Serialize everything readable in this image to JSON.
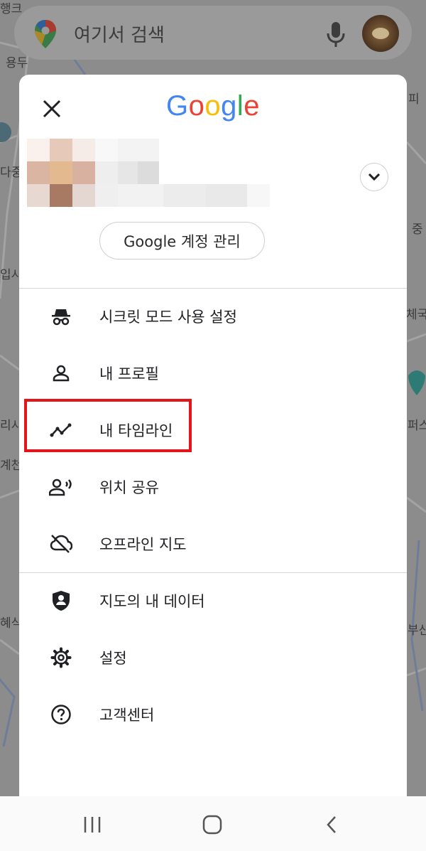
{
  "search": {
    "placeholder": "여기서 검색"
  },
  "panel": {
    "close_label": "close",
    "logo_letters": [
      {
        "ch": "G",
        "color": "#4285F4"
      },
      {
        "ch": "o",
        "color": "#EA4335"
      },
      {
        "ch": "o",
        "color": "#FBBC05"
      },
      {
        "ch": "g",
        "color": "#4285F4"
      },
      {
        "ch": "l",
        "color": "#34A853"
      },
      {
        "ch": "e",
        "color": "#EA4335"
      }
    ],
    "manage_account": "Google 계정 관리"
  },
  "menu": {
    "incognito": "시크릿 모드 사용 설정",
    "profile": "내 프로필",
    "timeline": "내 타임라인",
    "location_sharing": "위치 공유",
    "offline_maps": "오프라인 지도",
    "your_data": "지도의 내 데이터",
    "settings": "설정",
    "help": "고객센터"
  },
  "map_labels": [
    "행크",
    "용두",
    "다중",
    "입시",
    "체국",
    "리시",
    "계천",
    "혜식",
    "중",
    "부산",
    "피",
    "퍼스"
  ],
  "colors": {
    "highlight": "#e5141b",
    "icon": "#202124",
    "text": "#202124"
  },
  "icons": {
    "close": "close-icon",
    "expand": "chevron-down-icon",
    "incognito": "incognito-icon",
    "profile": "person-icon",
    "timeline": "timeline-icon",
    "location_sharing": "location-sharing-icon",
    "offline_maps": "cloud-off-icon",
    "your_data": "shield-person-icon",
    "settings": "gear-icon",
    "help": "help-icon",
    "nav_recent": "recent-apps-icon",
    "nav_home": "home-icon",
    "nav_back": "back-icon"
  }
}
